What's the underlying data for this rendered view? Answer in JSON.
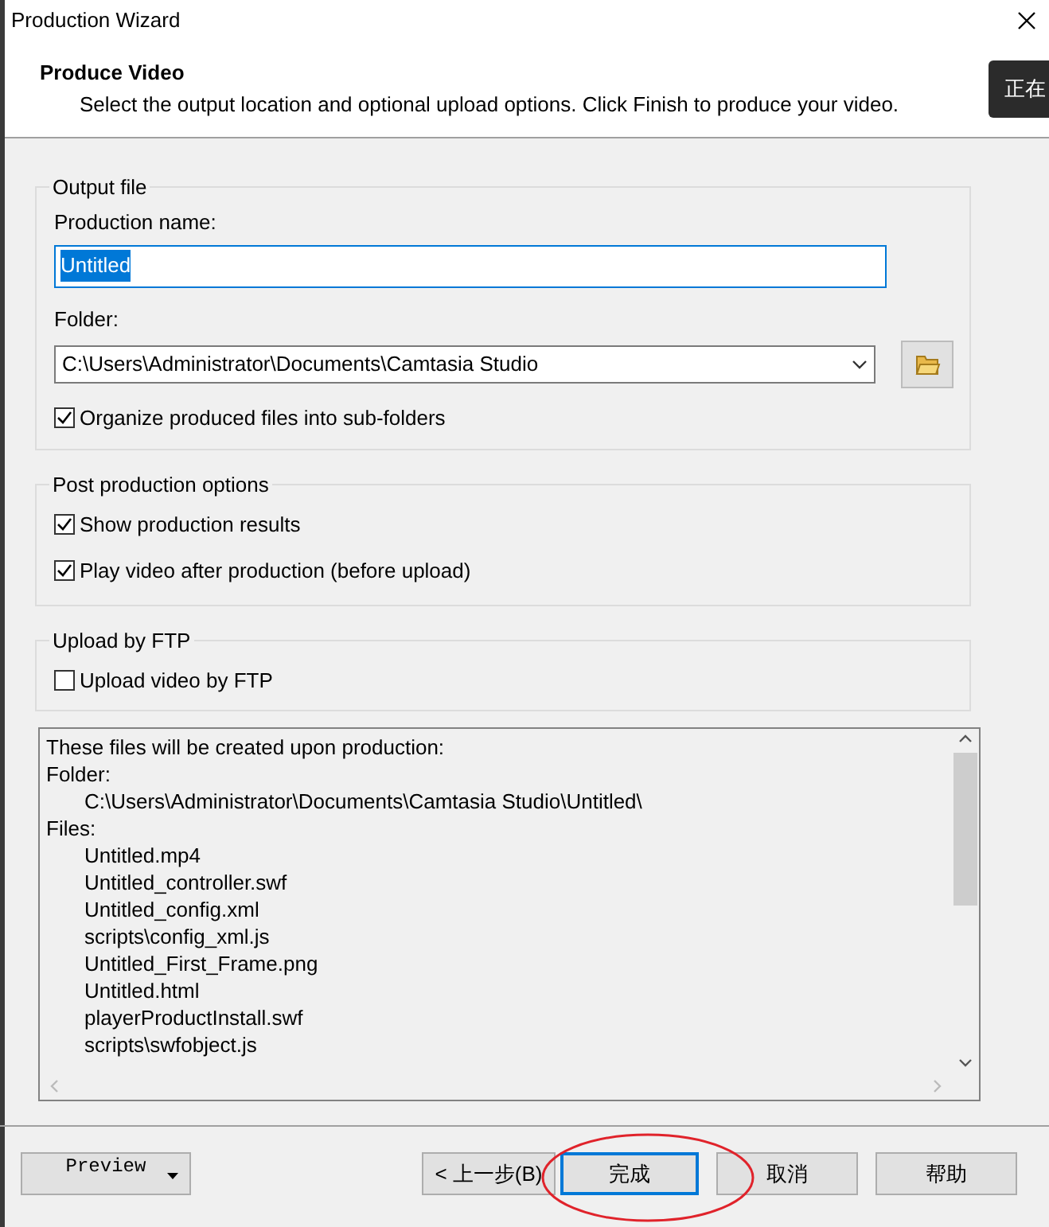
{
  "window": {
    "title": "Production Wizard"
  },
  "header": {
    "title": "Produce Video",
    "subtitle": "Select the output location and optional upload options. Click Finish to produce your video."
  },
  "side_tooltip": {
    "text": "正在"
  },
  "output_file": {
    "legend": "Output file",
    "name_label": "Production name:",
    "name_value": "Untitled",
    "folder_label": "Folder:",
    "folder_value": "C:\\Users\\Administrator\\Documents\\Camtasia Studio",
    "organize": {
      "label": "Organize produced files into sub-folders",
      "checked": true
    }
  },
  "post_production": {
    "legend": "Post production options",
    "options": [
      {
        "label": "Show production results",
        "checked": true
      },
      {
        "label": "Play video after production (before upload)",
        "checked": true
      }
    ]
  },
  "ftp": {
    "legend": "Upload by FTP",
    "options": [
      {
        "label": "Upload video by FTP",
        "checked": false
      }
    ]
  },
  "files_list": {
    "lines": [
      {
        "text": "These files will be created upon production:"
      },
      {
        "text": "Folder:",
        "children": [
          {
            "text": "C:\\Users\\Administrator\\Documents\\Camtasia Studio\\Untitled\\"
          }
        ]
      },
      {
        "text": "Files:",
        "children": [
          {
            "text": "Untitled.mp4"
          },
          {
            "text": "Untitled_controller.swf"
          },
          {
            "text": "Untitled_config.xml"
          },
          {
            "text": "scripts\\config_xml.js"
          },
          {
            "text": "Untitled_First_Frame.png"
          },
          {
            "text": "Untitled.html"
          },
          {
            "text": "playerProductInstall.swf"
          },
          {
            "text": "scripts\\swfobject.js"
          }
        ]
      }
    ]
  },
  "buttons": [
    {
      "kind": "dropdown",
      "label": "Preview",
      "default": false
    },
    {
      "kind": "push",
      "label": "< 上一步(B)",
      "default": false
    },
    {
      "kind": "push",
      "label": "完成",
      "default": true
    },
    {
      "kind": "push",
      "label": "取消",
      "default": false
    },
    {
      "kind": "push",
      "label": "帮助",
      "default": false
    }
  ]
}
